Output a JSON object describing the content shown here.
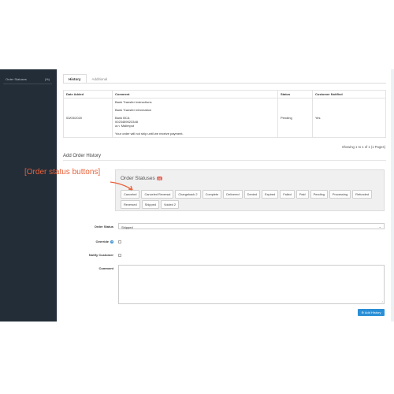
{
  "sidebar": {
    "item_label": "Order Statuses",
    "item_count": "(%)"
  },
  "tabs": {
    "history": "History",
    "additional": "Additional"
  },
  "history_table": {
    "headers": [
      "Date Added",
      "Comment",
      "Status",
      "Customer Notified"
    ],
    "row": {
      "date": "03/03/2020",
      "comment_lines": [
        "Bank Transfer Instructions",
        "",
        "Bank Transfer Information",
        "",
        "Bank BCA",
        "0023489023348",
        "a.n. Malimput",
        "",
        "Your order will not ship until we receive payment."
      ],
      "status": "Pending",
      "notified": "Yes"
    }
  },
  "pagination": {
    "text": "Showing 1 to 1 of 1 (1 Pages)"
  },
  "add_history": {
    "title": "Add Order History"
  },
  "annotation": {
    "label": "[Order status buttons]"
  },
  "statuses_panel": {
    "title": "Order Statuses",
    "count": "(•)",
    "buttons": [
      "Canceled",
      "Canceled Reversal",
      "Chargeback 2",
      "Complete",
      "Delivered",
      "Denied",
      "Expired",
      "Failed",
      "Paid",
      "Pending",
      "Processing",
      "Refunded",
      "Reversed",
      "Shipped",
      "Voided 2"
    ]
  },
  "form": {
    "order_status_label": "Order Status",
    "order_status_value": "Shipped",
    "override_label": "Override",
    "notify_label": "Notify Customer",
    "comment_label": "Comment",
    "add_button": "Add History",
    "add_icon": "plus-circle-icon"
  },
  "colors": {
    "accent": "#2a8fd6",
    "annotation": "#e8613a",
    "sidebar": "#232d38"
  }
}
